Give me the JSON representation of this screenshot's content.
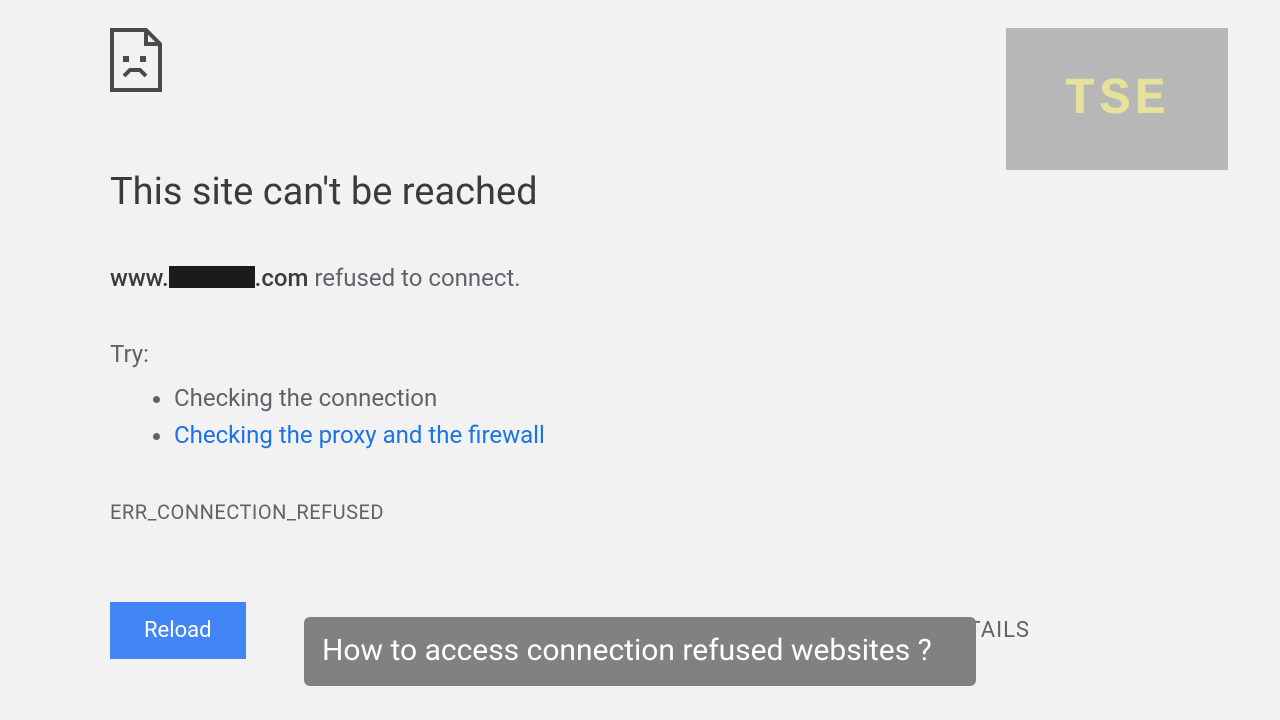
{
  "error": {
    "title": "This site can't be reached",
    "host_prefix": "www.",
    "host_suffix": ".com",
    "refused_text": " refused to connect.",
    "try_label": "Try:",
    "suggestions": [
      {
        "text": "Checking the connection",
        "link": false
      },
      {
        "text": "Checking the proxy and the firewall",
        "link": true
      }
    ],
    "code": "ERR_CONNECTION_REFUSED",
    "reload_label": "Reload",
    "details_label": "DETAILS"
  },
  "logo": {
    "text": "TSE"
  },
  "caption": {
    "text": "How to access connection refused websites ?"
  }
}
